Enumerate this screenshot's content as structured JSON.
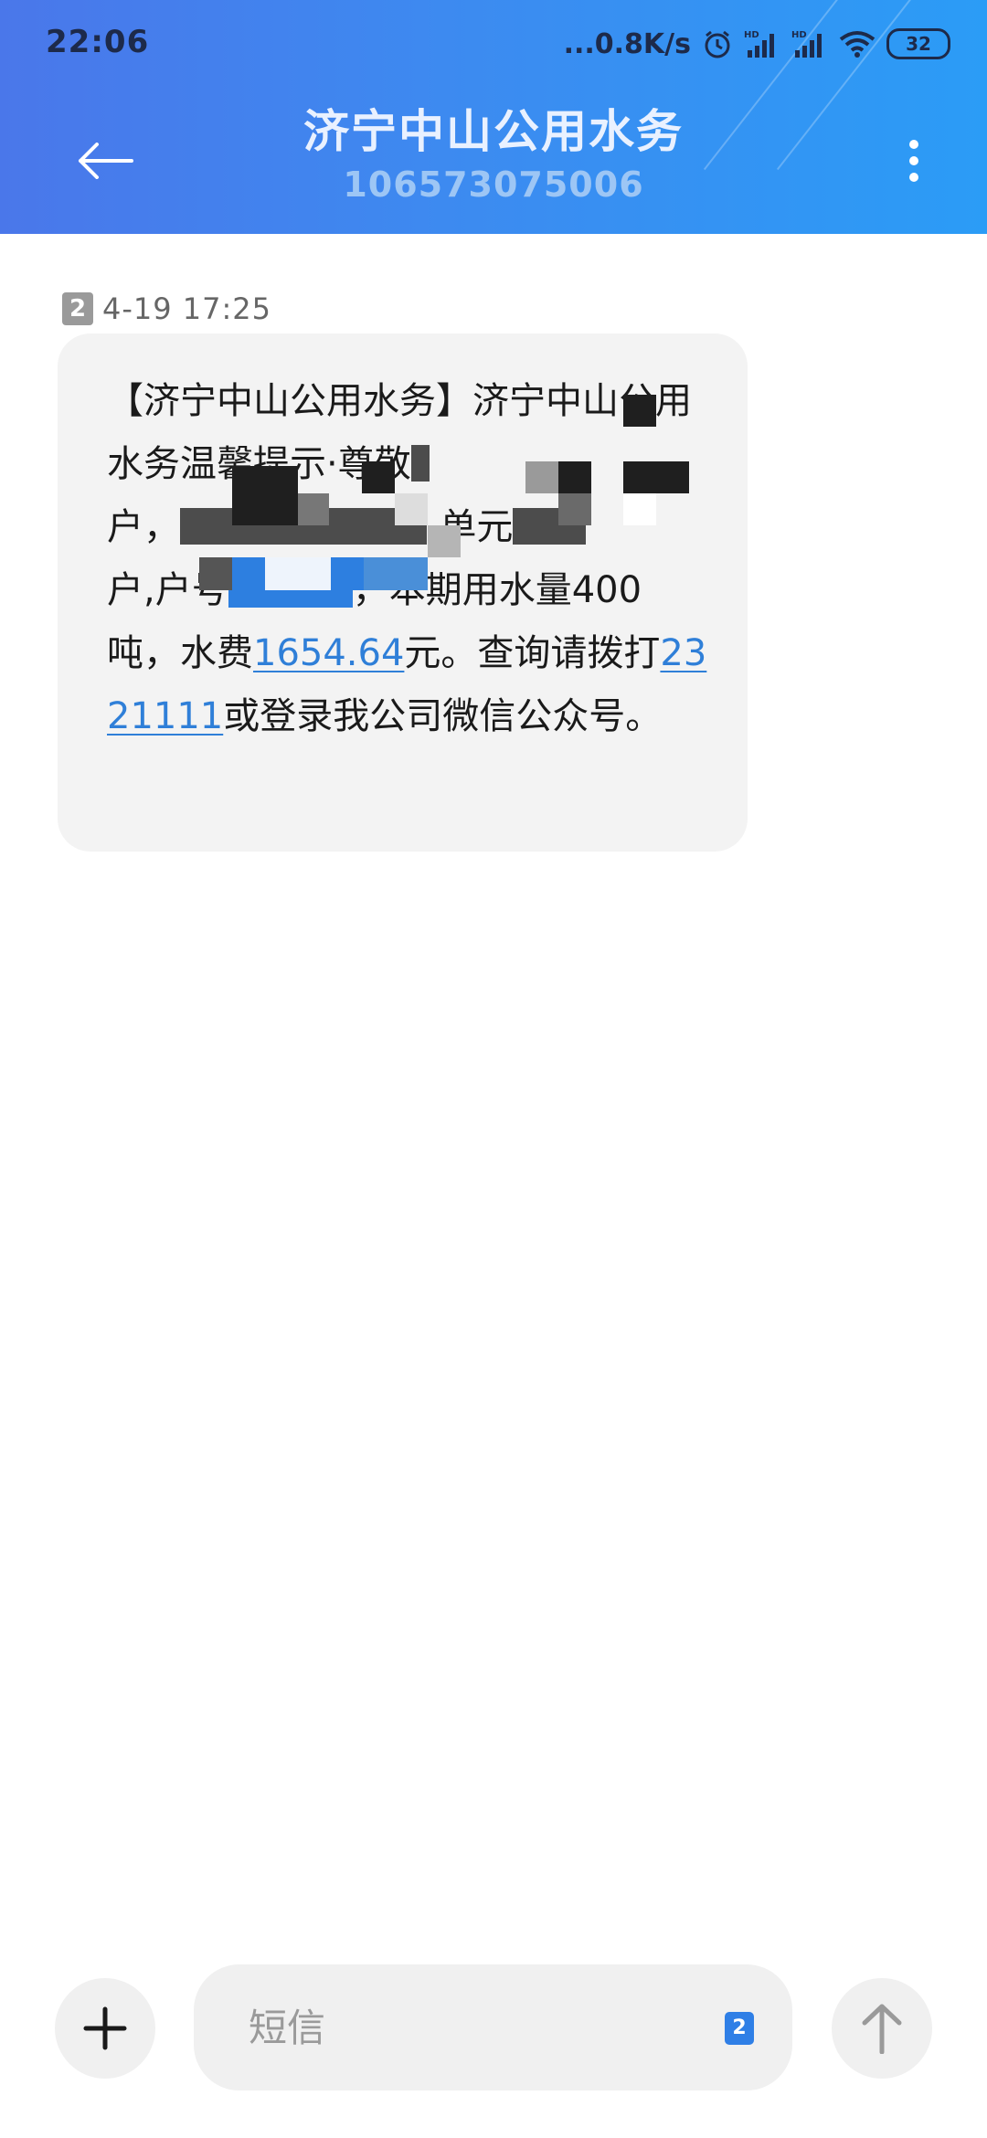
{
  "status_bar": {
    "time": "22:06",
    "net_speed": "...0.8K/s",
    "battery": "32",
    "icons": [
      "alarm-icon",
      "signal-hd-icon",
      "signal-hd-icon",
      "wifi-icon",
      "battery-icon"
    ]
  },
  "header": {
    "contact_name": "济宁中山公用水务",
    "contact_number": "106573075006",
    "back_icon": "back-arrow-icon",
    "menu_icon": "more-vertical-icon"
  },
  "conversation": {
    "messages": [
      {
        "sim": "2",
        "timestamp": "4-19 17:25",
        "segments": {
          "p1": "【济宁中山公用水务】济宁中山公用水务温馨提示·尊敬",
          "p2": "户，",
          "p3": "-单元",
          "p4": "户,户号",
          "p5": "，本期用水量400吨，水费",
          "amount": "1654.64",
          "p6": "元。查询请拨打",
          "phone": "2321111",
          "p7": "或登录我公司微信公众号。"
        }
      }
    ]
  },
  "composer": {
    "placeholder": "短信",
    "sim": "2",
    "attach_icon": "plus-icon",
    "send_icon": "send-arrow-icon"
  },
  "colors": {
    "header_start": "#4a77ea",
    "header_end": "#2b9cf6",
    "link": "#2f7fd8",
    "bubble": "#f3f3f3",
    "sim_badge": "#2f7fe6"
  }
}
